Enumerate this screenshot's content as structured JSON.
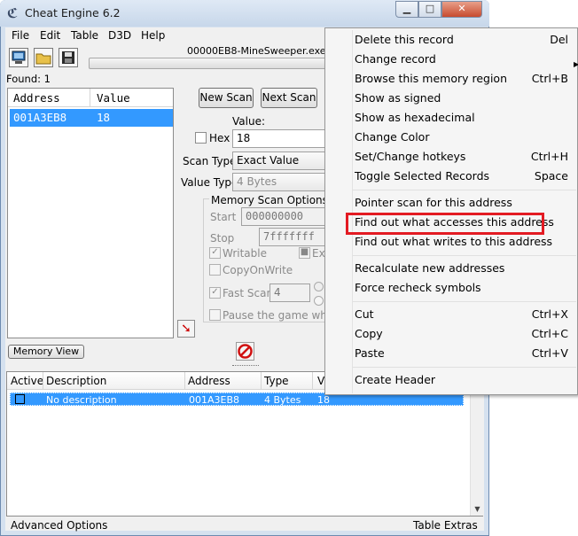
{
  "window": {
    "title": "Cheat Engine 6.2",
    "minimize": "▁",
    "maximize": "□",
    "close": "✕"
  },
  "menubar": [
    "File",
    "Edit",
    "Table",
    "D3D",
    "Help"
  ],
  "process_name": "00000EB8-MineSweeper.exe",
  "found_label": "Found: 1",
  "found_list": {
    "headers": [
      "Address",
      "Value"
    ],
    "rows": [
      {
        "address": "001A3EB8",
        "value": "18"
      }
    ]
  },
  "scan": {
    "new_scan": "New Scan",
    "next_scan": "Next Scan",
    "value_label": "Value:",
    "hex_label": "Hex",
    "value": "18",
    "scan_type_label": "Scan Type",
    "scan_type": "Exact Value",
    "value_type_label": "Value Type",
    "value_type": "4 Bytes",
    "memory_scan_options": "Memory Scan Options",
    "start_label": "Start",
    "start_value": "000000000",
    "stop_label": "Stop",
    "stop_value": "7fffffff",
    "writable": "Writable",
    "executable": "Ex",
    "copyonwrite": "CopyOnWrite",
    "fast_scan": "Fast Scan",
    "fast_scan_value": "4",
    "pause_game": "Pause the game while sc"
  },
  "memory_view": "Memory View",
  "address_table": {
    "headers": [
      "Active",
      "Description",
      "Address",
      "Type",
      "V"
    ],
    "rows": [
      {
        "description": "No description",
        "address": "001A3EB8",
        "type": "4 Bytes",
        "value": "18"
      }
    ]
  },
  "bottom": {
    "advanced_options": "Advanced Options",
    "table_extras": "Table Extras"
  },
  "context_menu": {
    "groups": [
      [
        {
          "label": "Delete this record",
          "shortcut": "Del"
        },
        {
          "label": "Change record",
          "shortcut": ""
        },
        {
          "label": "Browse this memory region",
          "shortcut": "Ctrl+B"
        },
        {
          "label": "Show as signed",
          "shortcut": ""
        },
        {
          "label": "Show as hexadecimal",
          "shortcut": ""
        },
        {
          "label": "Change Color",
          "shortcut": ""
        },
        {
          "label": "Set/Change hotkeys",
          "shortcut": "Ctrl+H"
        },
        {
          "label": "Toggle Selected Records",
          "shortcut": "Space"
        }
      ],
      [
        {
          "label": "Pointer scan for this address",
          "shortcut": ""
        },
        {
          "label": "Find out what accesses this address",
          "shortcut": ""
        },
        {
          "label": "Find out what writes to this address",
          "shortcut": ""
        }
      ],
      [
        {
          "label": "Recalculate new addresses",
          "shortcut": ""
        },
        {
          "label": "Force recheck symbols",
          "shortcut": ""
        }
      ],
      [
        {
          "label": "Cut",
          "shortcut": "Ctrl+X"
        },
        {
          "label": "Copy",
          "shortcut": "Ctrl+C"
        },
        {
          "label": "Paste",
          "shortcut": "Ctrl+V"
        }
      ],
      [
        {
          "label": "Create Header",
          "shortcut": ""
        }
      ]
    ],
    "highlighted": "Find out what accesses this address",
    "highlight_color": "#e31b23"
  },
  "colors": {
    "selection": "#3399ff",
    "window_frame": "#d5e1ef"
  }
}
